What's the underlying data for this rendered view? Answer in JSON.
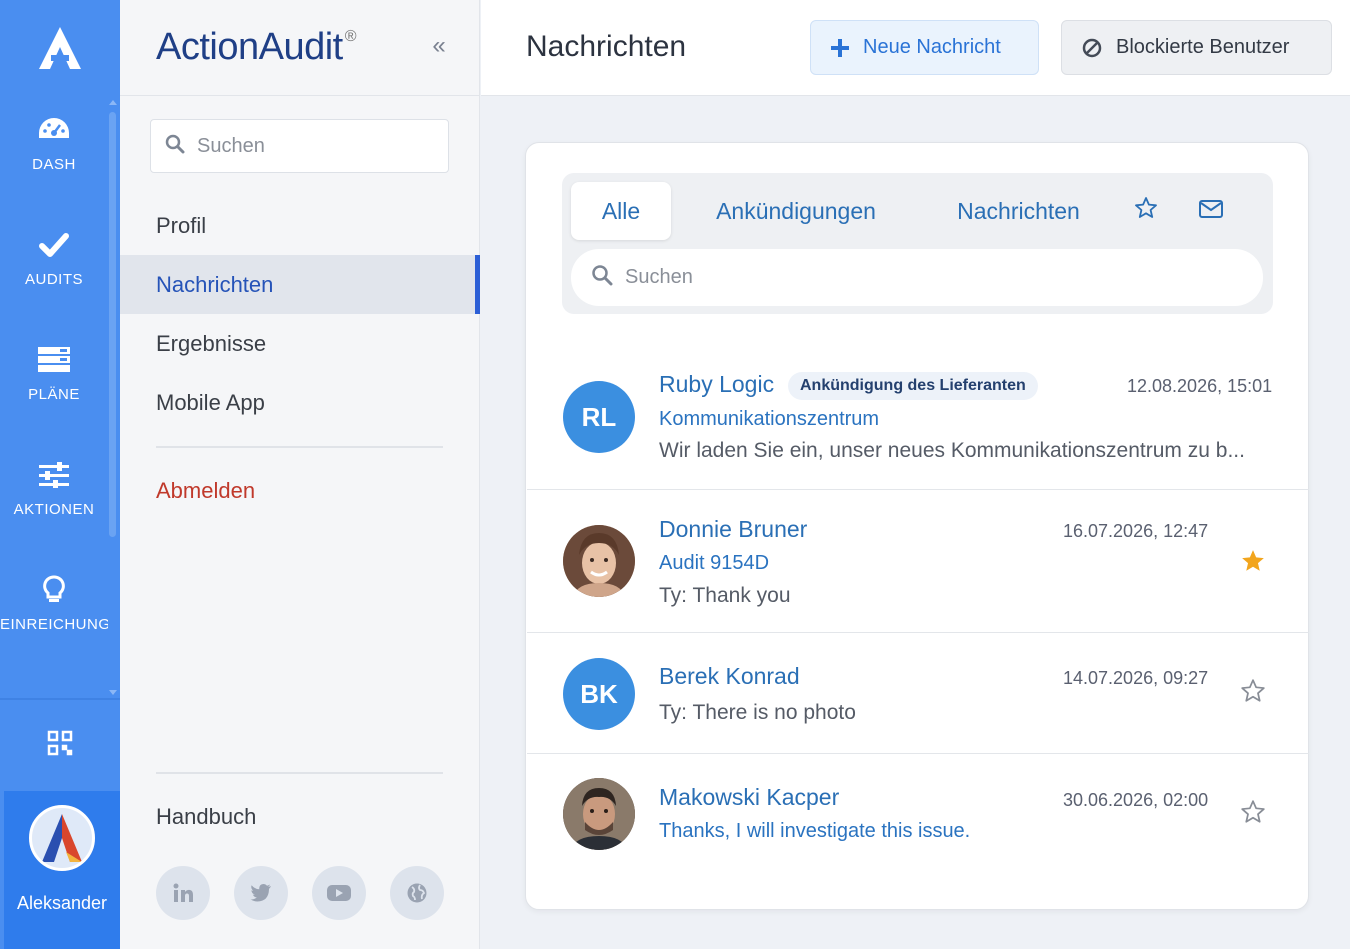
{
  "rail": {
    "items": [
      {
        "label": "DASH",
        "icon": "dashboard-icon"
      },
      {
        "label": "AUDITS",
        "icon": "check-icon"
      },
      {
        "label": "PLÄNE",
        "icon": "plans-icon"
      },
      {
        "label": "AKTIONEN",
        "icon": "sliders-icon"
      },
      {
        "label": "EINREICHUNG",
        "icon": "lightbulb-icon"
      }
    ],
    "user_name": "Aleksander"
  },
  "sidebar": {
    "brand": "ActionAudit",
    "brand_mark": "®",
    "search_placeholder": "Suchen",
    "items": [
      {
        "label": "Profil"
      },
      {
        "label": "Nachrichten"
      },
      {
        "label": "Ergebnisse"
      },
      {
        "label": "Mobile App"
      }
    ],
    "logout": "Abmelden",
    "manual": "Handbuch",
    "socials": [
      "linkedin-icon",
      "twitter-icon",
      "youtube-icon",
      "globe-icon"
    ]
  },
  "header": {
    "title": "Nachrichten",
    "new_message": "Neue Nachricht",
    "blocked_users": "Blockierte Benutzer"
  },
  "filters": {
    "tabs": [
      "Alle",
      "Ankündigungen",
      "Nachrichten"
    ],
    "active_tab": "Alle",
    "search_placeholder": "Suchen"
  },
  "messages": [
    {
      "initials": "RL",
      "sender": "Ruby Logic",
      "badge": "Ankündigung des Lieferanten",
      "date": "12.08.2026, 15:01",
      "subject": "Kommunikationszentrum",
      "preview": "Wir laden Sie ein, unser neues Kommunikationszentrum zu b...",
      "starred": null
    },
    {
      "initials": "",
      "sender": "Donnie Bruner",
      "date": "16.07.2026, 12:47",
      "subject": "Audit 9154D",
      "preview": "Ty: Thank you",
      "starred": true
    },
    {
      "initials": "BK",
      "sender": "Berek Konrad",
      "date": "14.07.2026, 09:27",
      "preview": "Ty: There is no photo",
      "starred": false
    },
    {
      "initials": "",
      "sender": "Makowski Kacper",
      "date": "30.06.2026, 02:00",
      "subject": "Thanks, I will investigate this issue.",
      "starred": false
    }
  ],
  "colors": {
    "rail": "#4a8ef0",
    "accent": "#2a6fb5",
    "danger": "#c0392b",
    "star_active": "#f2a51d"
  }
}
